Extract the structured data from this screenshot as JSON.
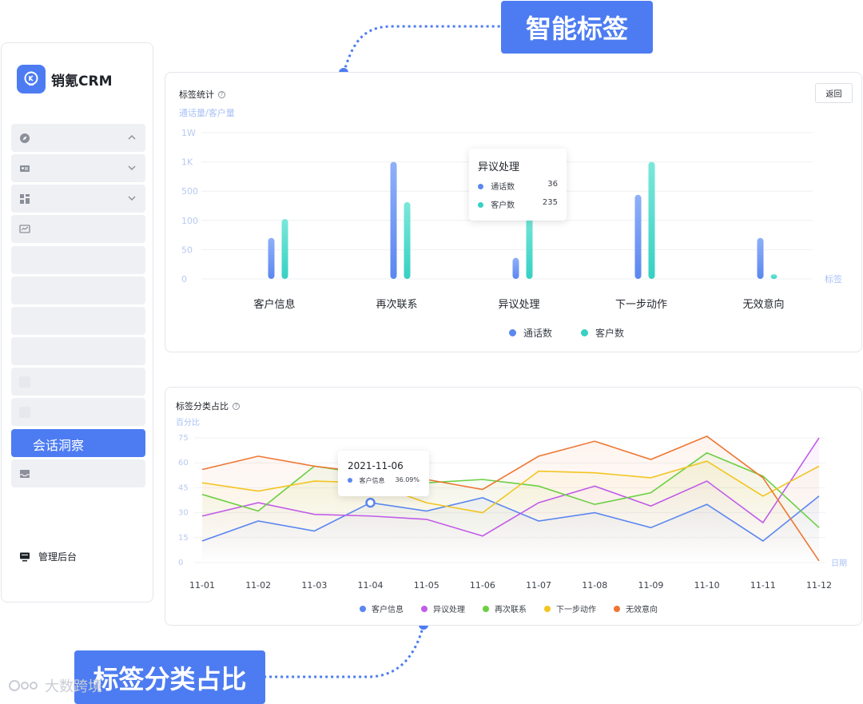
{
  "brand": {
    "name": "销氪CRM",
    "color": "#4d7cf2"
  },
  "sidebar": {
    "items": [
      {
        "icon": "compass-icon",
        "chevron": "chevron-up-icon"
      },
      {
        "icon": "id-card-icon",
        "chevron": "chevron-down-icon"
      },
      {
        "icon": "grid-icon",
        "chevron": "chevron-down-icon"
      },
      {
        "icon": "monitor-chart-icon"
      },
      {},
      {},
      {},
      {},
      {},
      {},
      {
        "label": "会话洞察",
        "active": true
      },
      {
        "icon": "inbox-icon"
      }
    ],
    "admin_label": "管理后台",
    "admin_icon": "monitor-icon"
  },
  "callouts": {
    "top": "智能标签",
    "bottom": "标签分类占比"
  },
  "watermark": "大数跨境",
  "card1": {
    "title": "标签统计",
    "back_label": "返回",
    "y_axis_name": "通话量/客户量",
    "x_axis_name": "标签",
    "tooltip": {
      "title": "异议处理",
      "rows": [
        {
          "label": "通话数",
          "value": "36"
        },
        {
          "label": "客户数",
          "value": "235"
        }
      ]
    },
    "legend": [
      "通话数",
      "客户数"
    ]
  },
  "card2": {
    "title": "标签分类占比",
    "y_axis_name": "百分比",
    "x_axis_name": "日期",
    "tooltip": {
      "title": "2021-11-06",
      "label": "客户信息",
      "value": "36.09%"
    },
    "legend": [
      "客户信息",
      "异议处理",
      "再次联系",
      "下一步动作",
      "无效意向"
    ]
  },
  "chart_data": [
    {
      "type": "bar",
      "title": "标签统计",
      "ylabel": "通话量/客户量",
      "xlabel": "标签",
      "y_ticks": [
        "0",
        "50",
        "100",
        "500",
        "1K",
        "1W"
      ],
      "categories": [
        "客户信息",
        "再次联系",
        "异议处理",
        "下一步动作",
        "无效意向"
      ],
      "series": [
        {
          "name": "通话数",
          "color": "#5b87f0",
          "values": [
            70,
            1000,
            36,
            450,
            70
          ]
        },
        {
          "name": "客户数",
          "color": "#36d1c4",
          "values": [
            120,
            350,
            235,
            1000,
            2
          ]
        }
      ]
    },
    {
      "type": "line",
      "title": "标签分类占比",
      "ylabel": "百分比",
      "xlabel": "日期",
      "y_ticks": [
        0,
        15,
        30,
        45,
        60,
        75
      ],
      "ylim": [
        0,
        75
      ],
      "categories": [
        "11-01",
        "11-02",
        "11-03",
        "11-04",
        "11-05",
        "11-06",
        "11-07",
        "11-08",
        "11-09",
        "11-10",
        "11-11",
        "11-12"
      ],
      "series": [
        {
          "name": "客户信息",
          "color": "#5b87f0",
          "values": [
            13,
            25,
            19,
            36,
            31,
            39,
            25,
            30,
            21,
            35,
            13,
            40
          ]
        },
        {
          "name": "异议处理",
          "color": "#c15ce8",
          "values": [
            28,
            36,
            29,
            28,
            26,
            16,
            36,
            46,
            34,
            49,
            24,
            75
          ]
        },
        {
          "name": "再次联系",
          "color": "#6ccf44",
          "values": [
            41,
            31,
            58,
            53,
            48,
            50,
            46,
            35,
            42,
            66,
            52,
            21
          ]
        },
        {
          "name": "下一步动作",
          "color": "#f2c522",
          "values": [
            48,
            43,
            49,
            48,
            36,
            30,
            55,
            54,
            51,
            61,
            40,
            58
          ]
        },
        {
          "name": "无效意向",
          "color": "#ee7632",
          "values": [
            56,
            64,
            58,
            54,
            50,
            44,
            64,
            73,
            62,
            76,
            51,
            1
          ]
        }
      ],
      "highlight": {
        "series": "客户信息",
        "category": "11-04",
        "value": "36.09%"
      }
    }
  ]
}
